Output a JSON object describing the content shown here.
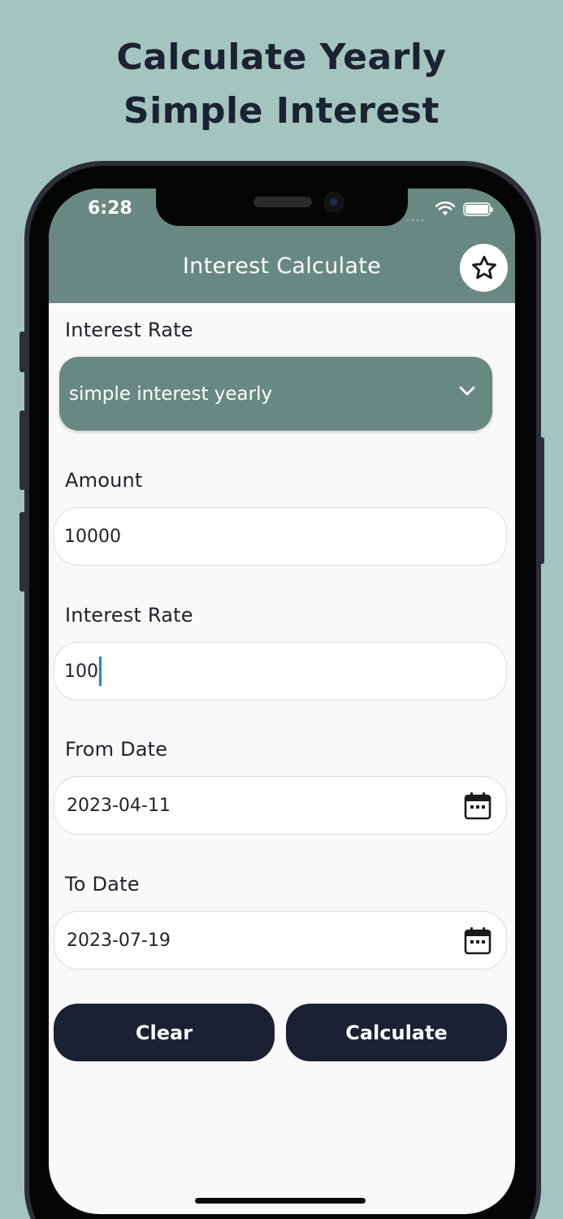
{
  "promo": {
    "headline_line1": "Calculate Yearly",
    "headline_line2": "Simple Interest"
  },
  "status_bar": {
    "time": "6:28"
  },
  "app_bar": {
    "title": "Interest Calculate",
    "favorite_icon": "star-outline-icon"
  },
  "form": {
    "interest_type": {
      "label": "Interest Rate",
      "selected": "simple interest yearly",
      "icon": "chevron-down-icon"
    },
    "amount": {
      "label": "Amount",
      "value": "10000"
    },
    "interest_rate": {
      "label": "Interest Rate",
      "value": "100"
    },
    "from_date": {
      "label": "From Date",
      "value": "2023-04-11",
      "icon": "calendar-icon"
    },
    "to_date": {
      "label": "To Date",
      "value": "2023-07-19",
      "icon": "calendar-icon"
    }
  },
  "actions": {
    "clear_label": "Clear",
    "calculate_label": "Calculate"
  },
  "colors": {
    "background": "#a4c4c0",
    "app_bar": "#688982",
    "button": "#1b2133",
    "caret": "#2b7de9"
  }
}
